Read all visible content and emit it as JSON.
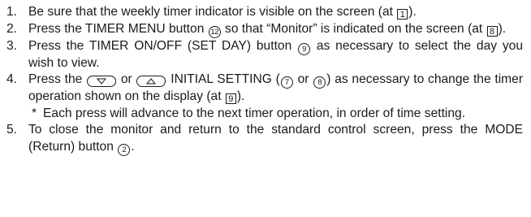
{
  "steps": [
    {
      "number": "1.",
      "before": "Be sure that the weekly timer indicator is visible on the screen (at ",
      "ref": "1",
      "after": ")."
    },
    {
      "number": "2.",
      "before": "Press the TIMER MENU button ",
      "button": "12",
      "middle": " so that “Monitor” is indicated on the screen (at ",
      "ref": "8",
      "after": ")."
    },
    {
      "number": "3.",
      "before": "Press the TIMER ON/OFF (SET DAY) button ",
      "button": "9",
      "after": " as necessary to select the day you wish to view."
    },
    {
      "number": "4.",
      "before": "Press the ",
      "or_text": " or ",
      "initial": " INITIAL SETTING (",
      "btn_a": "7",
      "or2": " or ",
      "btn_b": "8",
      "mid": ") as necessary to change the timer operation shown on the display (at ",
      "ref": "9",
      "after": ").",
      "note_mark": "*",
      "note": "Each press will advance to the next timer operation, in order of time setting."
    },
    {
      "number": "5.",
      "before": "To close the monitor and return to the standard control screen, press the MODE (Return) button ",
      "button": "2",
      "after": "."
    }
  ],
  "icons": {
    "down": "down-triangle-button-icon",
    "up": "up-triangle-button-icon"
  }
}
